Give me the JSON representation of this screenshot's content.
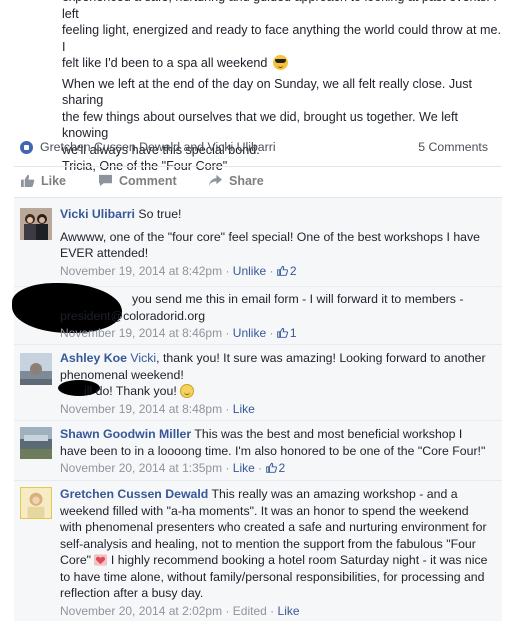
{
  "post": {
    "line_1": "experienced a safe, nurturing and guided approach to looking at past events. I left",
    "line_2": "feeling light, energized and ready to face anything the world could throw at me. I",
    "line_3": "felt like I'd been to a spa all weekend",
    "line_3_emoji": "sunglasses-emoji",
    "line_4": "When we left at the end of the day on Sunday, we all felt really close. Just sharing",
    "line_5": "the few things about ourselves that we did, brought us together. We left knowing",
    "line_6": "we'll always have this special bond.",
    "line_7": "Tricia, One of the \"Four Core\""
  },
  "likes_bar": {
    "names": "Gretchen Cussen Dewald and Vicki Ulibarri",
    "comments_count": "5 Comments"
  },
  "actions": {
    "like": "Like",
    "comment": "Comment",
    "share": "Share"
  },
  "comments": [
    {
      "author": "Vicki Ulibarri",
      "text_1": "So true!",
      "text_2": "Awwww, one of the \"four core\" feel special! One of the best workshops I have EVER attended!",
      "timestamp": "November 19, 2014 at 8:42pm",
      "sep": "·",
      "action": "Unlike",
      "sep2": "·",
      "likes": "2"
    },
    {
      "author": "",
      "text_1": "you send me this in email form - I will forward it to members -",
      "text_2": "president@coloradorid.org",
      "timestamp": "November 19, 2014 at 8:46pm",
      "sep": "·",
      "action": "Unlike",
      "sep2": "·",
      "likes": "1"
    },
    {
      "author": "Ashley Koe",
      "mention": "Vicki",
      "text_1": ", thank you! It sure was amazing! Looking forward to another phenomenal weekend!",
      "text_2": "ill do! Thank you!",
      "timestamp": "November 19, 2014 at 8:48pm",
      "sep": "·",
      "action": "Like"
    },
    {
      "author": "Shawn Goodwin Miller",
      "text_1": "This was the best and most beneficial workshop I have been to in a loooong time. I'm also honored to be one of the \"Core Four!\"",
      "timestamp": "November 20, 2014 at 1:35pm",
      "sep": "·",
      "action": "Like",
      "sep2": "·",
      "likes": "2"
    },
    {
      "author": "Gretchen Cussen Dewald",
      "text_1": "This really was an amazing workshop - and a weekend filled with \"a-ha moments\". It was an honor to spend the weekend with phenomenal presenters who created a safe and nurturing environment for self-analysis and healing, not to mention the support from the fabulous \"Four Core\"",
      "text_2": "I highly recommend booking a hotel room Saturday night - it was nice to have time alone, without family/personal responsibilities, for processing and reflection after a busy day.",
      "timestamp": "November 20, 2014 at 2:02pm",
      "sep": "·",
      "edited": "Edited",
      "sep2": "·",
      "action": "Like"
    }
  ],
  "colors": {
    "link": "#365899",
    "meta": "#90949c",
    "comments_bg": "#f6f7f9",
    "redaction": "#000000"
  }
}
